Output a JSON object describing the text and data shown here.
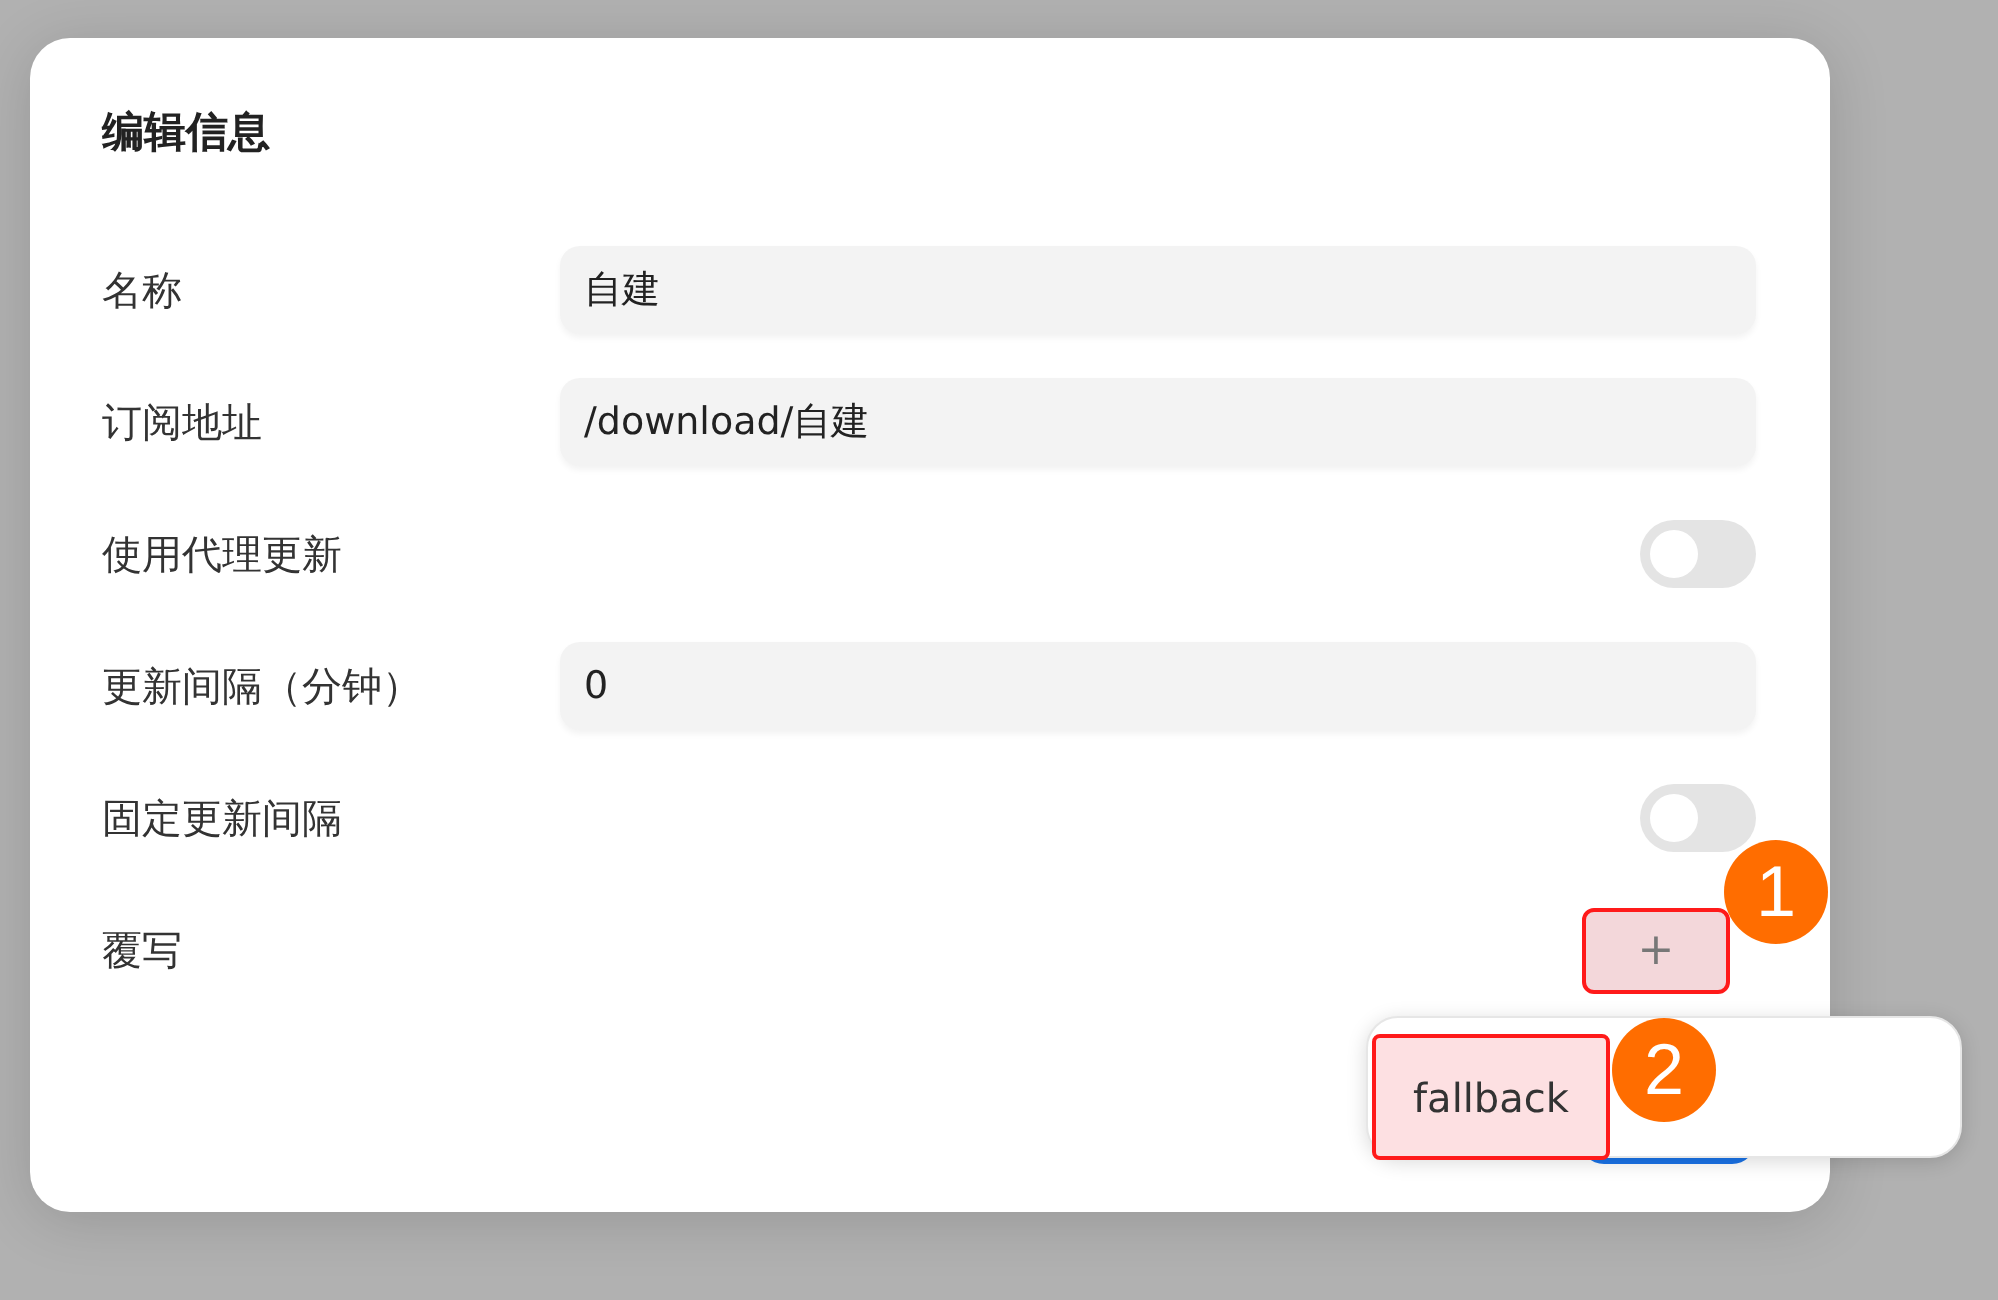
{
  "dialog": {
    "title": "编辑信息",
    "fields": [
      {
        "kind": "text",
        "label": "名称",
        "value": "自建"
      },
      {
        "kind": "text",
        "label": "订阅地址",
        "value": "/download/自建"
      },
      {
        "kind": "switch",
        "label": "使用代理更新",
        "on": false
      },
      {
        "kind": "text",
        "label": "更新间隔（分钟）",
        "value": "0"
      },
      {
        "kind": "switch",
        "label": "固定更新间隔",
        "on": false
      },
      {
        "kind": "add",
        "label": "覆写",
        "button": "+",
        "highlighted": true
      }
    ]
  },
  "menu": {
    "items": [
      {
        "label": "fallback",
        "highlighted": true
      }
    ]
  },
  "annotations": [
    "1",
    "2"
  ]
}
